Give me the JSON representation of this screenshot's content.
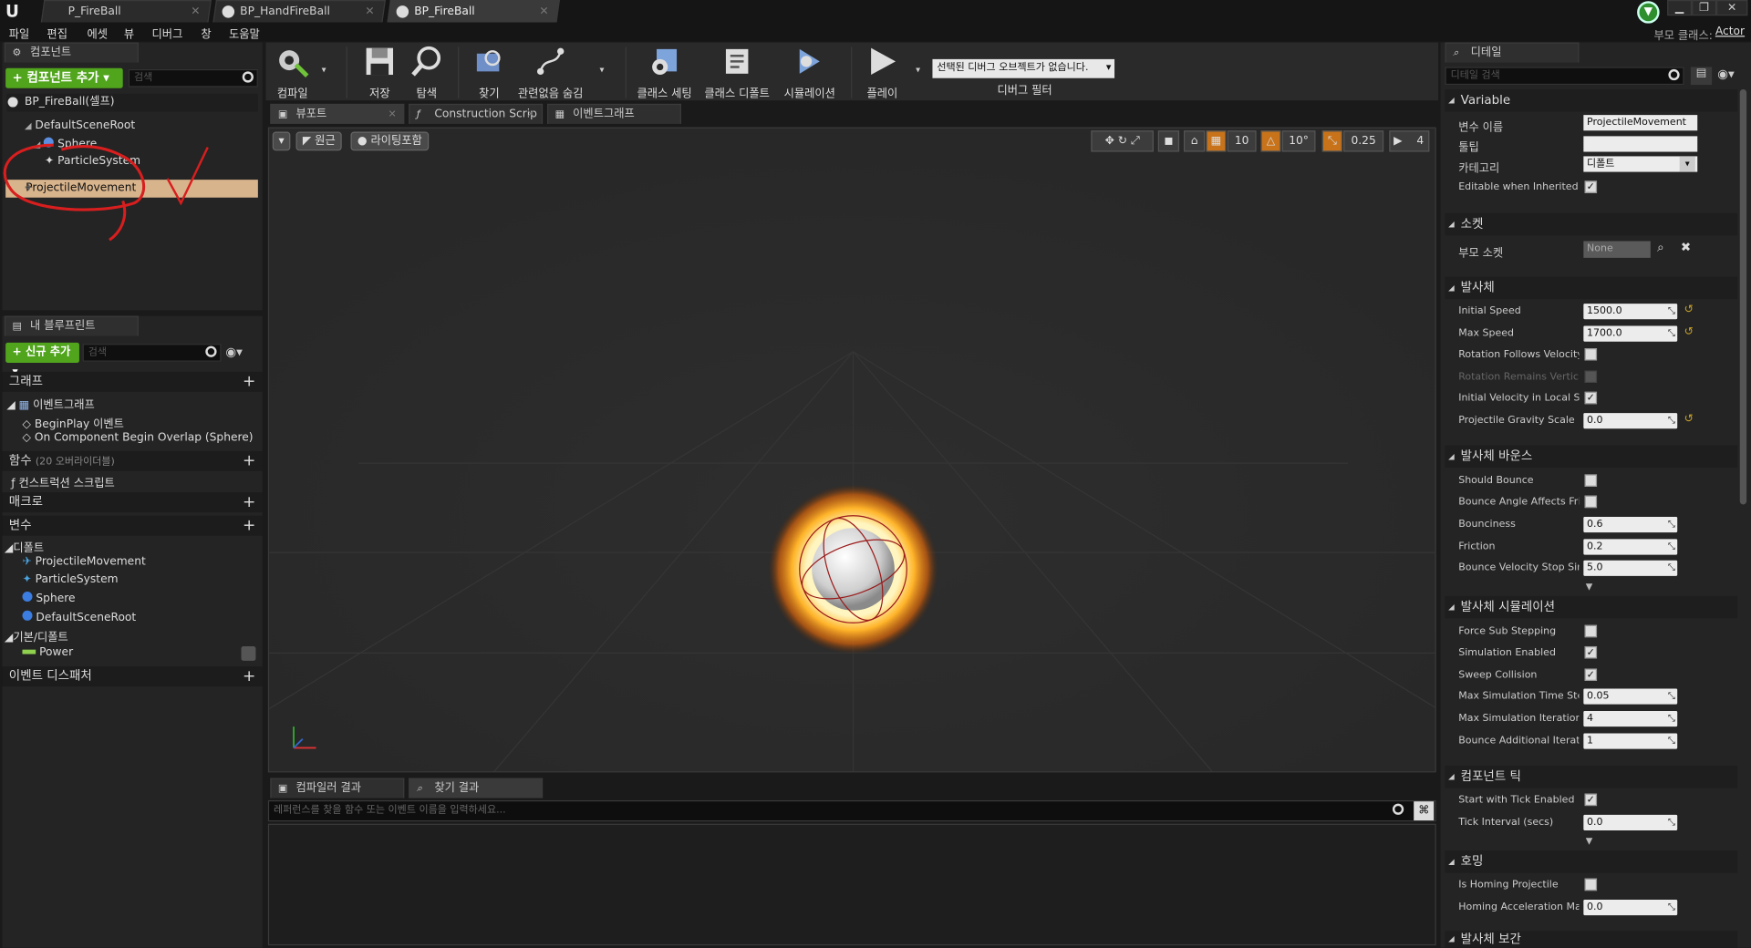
{
  "doc_tabs": [
    "P_FireBall",
    "BP_HandFireBall",
    "BP_FireBall"
  ],
  "menu": [
    "파일",
    "편집",
    "에셋",
    "뷰",
    "디버그",
    "창",
    "도움말"
  ],
  "parent_class": {
    "label": "부모 클래스:",
    "value": "Actor"
  },
  "components": {
    "tab": "컴포넌트",
    "add_button": "+ 컴포넌트 추가 ▾",
    "search_placeholder": "검색",
    "self_item": "BP_FireBall(셀프)",
    "tree": [
      "DefaultSceneRoot",
      "Sphere",
      "ParticleSystem",
      "ProjectileMovement"
    ]
  },
  "my_blueprint": {
    "tab": "내 블루프린트",
    "add_button": "+ 신규 추가 ▾",
    "search_placeholder": "검색",
    "graph_cat": "그래프",
    "event_graph": "이벤트그래프",
    "events": [
      "BeginPlay 이벤트",
      "On Component Begin Overlap (Sphere)"
    ],
    "functions_cat": "함수",
    "functions_note": "(20 오버라이더블)",
    "construction": "컨스트럭션 스크립트",
    "macros_cat": "매크로",
    "variables_cat": "변수",
    "defaults_cat": "디폴트",
    "default_vars": [
      "ProjectileMovement",
      "ParticleSystem",
      "Sphere",
      "DefaultSceneRoot"
    ],
    "basic_cat": "기본/디폴트",
    "basic_vars": [
      "Power"
    ],
    "dispatcher_cat": "이벤트 디스패처"
  },
  "toolbar": [
    {
      "label": "컴파일",
      "icon": "compile-icon"
    },
    {
      "label": "저장",
      "icon": "save-icon"
    },
    {
      "label": "탐색",
      "icon": "browse-icon"
    },
    {
      "label": "찾기",
      "icon": "find-icon"
    },
    {
      "label": "관련없음 숨김",
      "icon": "hide-unrelated-icon"
    },
    {
      "label": "클래스 세팅",
      "icon": "class-settings-icon"
    },
    {
      "label": "클래스 디폴트",
      "icon": "class-defaults-icon"
    },
    {
      "label": "시뮬레이션",
      "icon": "simulation-icon"
    },
    {
      "label": "플레이",
      "icon": "play-icon"
    }
  ],
  "debug": {
    "select": "선택된 디버그 오브젝트가 없습니다.",
    "label": "디버그 필터"
  },
  "editor_tabs": [
    "뷰포트",
    "Construction Scrip",
    "이벤트그래프"
  ],
  "viewport": {
    "perspective": "원근",
    "lighting": "라이팅포함",
    "grid_snap": "10",
    "rot_snap": "10°",
    "scale_snap": "0.25",
    "cam_speed": "4"
  },
  "bottom": {
    "tabs": [
      "컴파일러 결과",
      "찾기 결과"
    ],
    "find_placeholder": "레퍼런스를 찾을 함수 또는 이벤트 이름을 입력하세요..."
  },
  "details": {
    "tab": "디테일",
    "search_placeholder": "디테일 검색",
    "sections": {
      "variable": "Variable",
      "socket": "소켓",
      "projectile": "발사체",
      "bounce": "발사체 바운스",
      "sim": "발사체 시뮬레이션",
      "tick": "컴포넌트 틱",
      "homing": "호밍",
      "more": "발사체 보간"
    },
    "var_name_lbl": "변수 이름",
    "var_name": "ProjectileMovement",
    "tooltip_lbl": "툴팁",
    "tooltip": "",
    "category_lbl": "카테고리",
    "category": "디폴트",
    "editable_lbl": "Editable when Inherited",
    "parent_socket_lbl": "부모 소켓",
    "parent_socket": "None",
    "initial_speed_lbl": "Initial Speed",
    "initial_speed": "1500.0",
    "max_speed_lbl": "Max Speed",
    "max_speed": "1700.0",
    "rot_follows_lbl": "Rotation Follows Velocity",
    "rot_vertical_lbl": "Rotation Remains Vertical",
    "init_local_lbl": "Initial Velocity in Local Space",
    "gravity_lbl": "Projectile Gravity Scale",
    "gravity": "0.0",
    "should_bounce_lbl": "Should Bounce",
    "bounce_angle_lbl": "Bounce Angle Affects Friction",
    "bounciness_lbl": "Bounciness",
    "bounciness": "0.6",
    "friction_lbl": "Friction",
    "friction": "0.2",
    "bounce_stop_lbl": "Bounce Velocity Stop Simulating Threshold",
    "bounce_stop": "5.0",
    "force_sub_lbl": "Force Sub Stepping",
    "sim_enabled_lbl": "Simulation Enabled",
    "sweep_lbl": "Sweep Collision",
    "max_time_lbl": "Max Simulation Time Step",
    "max_time": "0.05",
    "max_iter_lbl": "Max Simulation Iterations",
    "max_iter": "4",
    "bounce_add_lbl": "Bounce Additional Iterations",
    "bounce_add": "1",
    "start_tick_lbl": "Start with Tick Enabled",
    "tick_interval_lbl": "Tick Interval (secs)",
    "tick_interval": "0.0",
    "is_homing_lbl": "Is Homing Projectile",
    "homing_accel_lbl": "Homing Acceleration Magnitude",
    "homing_accel": "0.0"
  }
}
